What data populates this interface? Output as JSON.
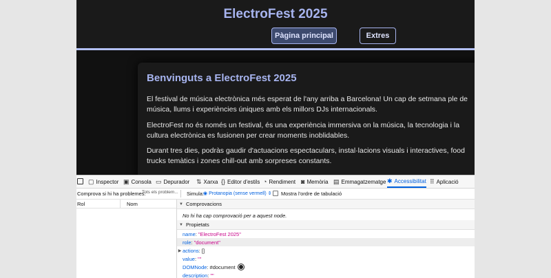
{
  "site": {
    "title": "ElectroFest 2025",
    "nav": [
      "Pàgina principal",
      "Extres"
    ],
    "heading": "Benvinguts a ElectroFest 2025",
    "paragraphs": [
      "El festival de música electrònica més esperat de l'any arriba a Barcelona! Un cap de setmana ple de música, llums i experiències úniques amb els millors DJs internacionals.",
      "ElectroFest no és només un festival, és una experiència immersiva on la música, la tecnologia i la cultura electrònica es fusionen per crear moments inoblidables.",
      "Durant tres dies, podràs gaudir d'actuacions espectaculars, instal·lacions visuals i interactives, food trucks temàtics i zones chill-out amb sorpreses constants."
    ]
  },
  "devtools": {
    "tabs": [
      {
        "label": "Inspector",
        "icon": "inspector-icon",
        "glyph": "▢"
      },
      {
        "label": "Consola",
        "icon": "console-icon",
        "glyph": "▣"
      },
      {
        "label": "Depurador",
        "icon": "debugger-icon",
        "glyph": "▭"
      },
      {
        "label": "Xarxa",
        "icon": "network-icon",
        "glyph": "⇅"
      },
      {
        "label": "Editor d'estils",
        "icon": "style-editor-icon",
        "glyph": "{}"
      },
      {
        "label": "Rendiment",
        "icon": "performance-icon",
        "glyph": "◔"
      },
      {
        "label": "Memòria",
        "icon": "memory-icon",
        "glyph": "◙"
      },
      {
        "label": "Emmagatzematge",
        "icon": "storage-icon",
        "glyph": "▤"
      },
      {
        "label": "Accessibilitat",
        "icon": "accessibility-icon",
        "glyph": "✱"
      },
      {
        "label": "Aplicació",
        "icon": "application-icon",
        "glyph": "⠿"
      }
    ],
    "toolbar": {
      "check_label": "Comprova si hi ha problemes:",
      "check_value": "Tots els problem...",
      "simulate_label": "Simula:",
      "simulate_value": "Protanopia (sense vermell)",
      "tab_order_label": "Mostra l'ordre de tabulació"
    },
    "tree": {
      "col_role": "Rol",
      "col_name": "Nom"
    },
    "checks": {
      "title": "Comprovacions",
      "message": "No hi ha cap comprovació per a aquest node."
    },
    "properties": {
      "title": "Propietats",
      "name_key": "name",
      "name_value": "\"ElectroFest 2025\"",
      "role_key": "role",
      "role_value": "\"document\"",
      "actions_key": "actions",
      "actions_value": "[]",
      "value_key": "value",
      "value_value": "\"\"",
      "domnode_key": "DOMNode",
      "domnode_value": "#document",
      "description_key": "description",
      "description_value": "\"\""
    }
  }
}
